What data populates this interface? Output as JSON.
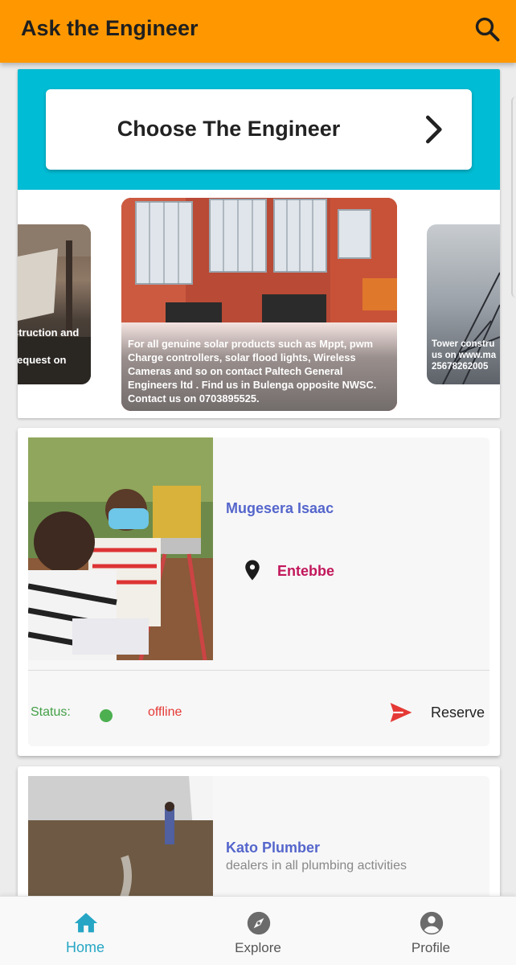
{
  "app": {
    "title": "Ask the Engineer"
  },
  "header": {
    "search_icon": "search-icon"
  },
  "choose": {
    "label": "Choose The Engineer"
  },
  "carousel": {
    "left_caption_line1": "struction and",
    "left_caption_line2": "request on",
    "center_caption": "For all genuine solar products such as Mppt, pwm Charge controllers, solar flood lights, Wireless Cameras and so on contact Paltech General Engineers ltd . Find us in Bulenga opposite NWSC. Contact us on 0703895525.",
    "right_caption_line1": "Tower constru",
    "right_caption_line2": "us on www.ma",
    "right_caption_line3": "25678262005"
  },
  "engineers": [
    {
      "name": "Mugesera Isaac",
      "location": "Entebbe",
      "status_label": "Status:",
      "status_value": "offline",
      "reserve_label": "Reserve"
    },
    {
      "name": "Kato Plumber",
      "description": "dealers in all plumbing activities"
    }
  ],
  "colors": {
    "app_bar": "#ff9800",
    "band": "#00bcd4",
    "name": "#5566cc",
    "location": "#c2185b",
    "status_online_dot": "#4caf50",
    "status_offline": "#e53935",
    "nav_active": "#26a6c4"
  },
  "nav": {
    "home": "Home",
    "explore": "Explore",
    "profile": "Profile"
  }
}
